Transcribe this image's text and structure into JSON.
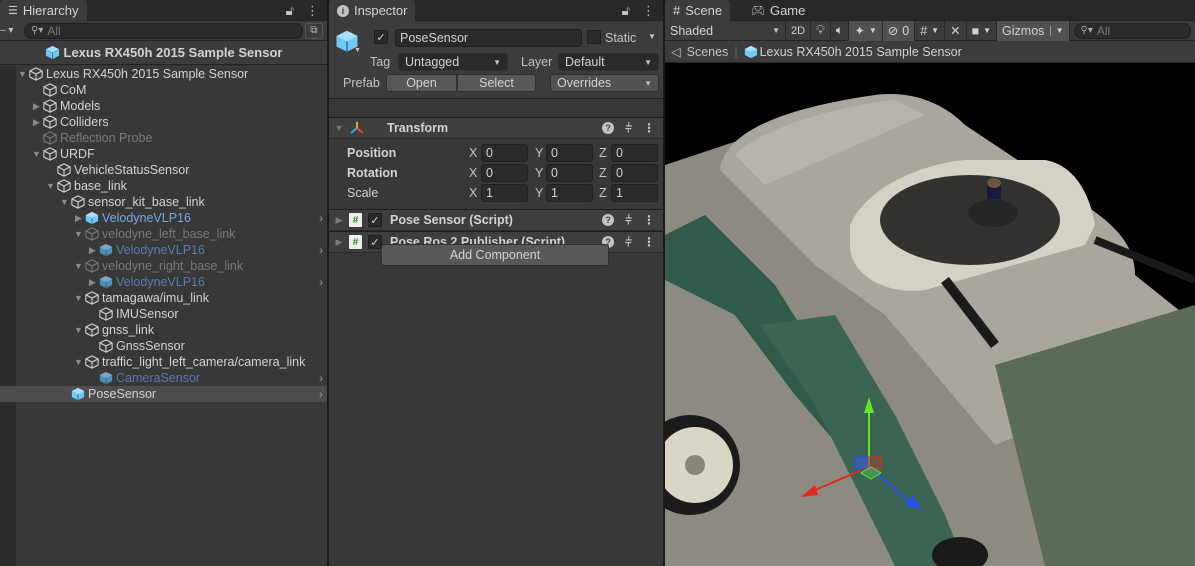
{
  "hierarchy": {
    "tab_label": "Hierarchy",
    "search_placeholder": "All",
    "prefab_header": "Lexus RX450h 2015 Sample Sensor",
    "items": [
      {
        "label": "Lexus RX450h 2015 Sample Sensor",
        "depth": 0,
        "arrow": "down",
        "type": "object"
      },
      {
        "label": "CoM",
        "depth": 1,
        "arrow": "none",
        "type": "object"
      },
      {
        "label": "Models",
        "depth": 1,
        "arrow": "right",
        "type": "object"
      },
      {
        "label": "Colliders",
        "depth": 1,
        "arrow": "right",
        "type": "object"
      },
      {
        "label": "Reflection Probe",
        "depth": 1,
        "arrow": "none",
        "type": "object-disabled"
      },
      {
        "label": "URDF",
        "depth": 1,
        "arrow": "down",
        "type": "object"
      },
      {
        "label": "VehicleStatusSensor",
        "depth": 2,
        "arrow": "none",
        "type": "object"
      },
      {
        "label": "base_link",
        "depth": 2,
        "arrow": "down",
        "type": "object"
      },
      {
        "label": "sensor_kit_base_link",
        "depth": 3,
        "arrow": "down",
        "type": "object"
      },
      {
        "label": "VelodyneVLP16",
        "depth": 4,
        "arrow": "right",
        "type": "prefab",
        "chevron": true
      },
      {
        "label": "velodyne_left_base_link",
        "depth": 4,
        "arrow": "down",
        "type": "object-disabled"
      },
      {
        "label": "VelodyneVLP16",
        "depth": 5,
        "arrow": "right",
        "type": "prefab-disabled",
        "chevron": true
      },
      {
        "label": "velodyne_right_base_link",
        "depth": 4,
        "arrow": "down",
        "type": "object-disabled"
      },
      {
        "label": "VelodyneVLP16",
        "depth": 5,
        "arrow": "right",
        "type": "prefab-disabled",
        "chevron": true
      },
      {
        "label": "tamagawa/imu_link",
        "depth": 4,
        "arrow": "down",
        "type": "object"
      },
      {
        "label": "IMUSensor",
        "depth": 5,
        "arrow": "none",
        "type": "object"
      },
      {
        "label": "gnss_link",
        "depth": 4,
        "arrow": "down",
        "type": "object"
      },
      {
        "label": "GnssSensor",
        "depth": 5,
        "arrow": "none",
        "type": "object"
      },
      {
        "label": "traffic_light_left_camera/camera_link",
        "depth": 4,
        "arrow": "down",
        "type": "object"
      },
      {
        "label": "CameraSensor",
        "depth": 5,
        "arrow": "none",
        "type": "prefab-disabled",
        "chevron": true
      },
      {
        "label": "PoseSensor",
        "depth": 3,
        "arrow": "none",
        "type": "prefab-selected",
        "chevron": true,
        "selected": true
      }
    ]
  },
  "inspector": {
    "tab_label": "Inspector",
    "object_name": "PoseSensor",
    "active": true,
    "static_label": "Static",
    "static_checked": false,
    "tag_label": "Tag",
    "tag_value": "Untagged",
    "layer_label": "Layer",
    "layer_value": "Default",
    "prefab_label": "Prefab",
    "prefab_open": "Open",
    "prefab_select": "Select",
    "prefab_overrides": "Overrides",
    "transform": {
      "title": "Transform",
      "rows": [
        {
          "label": "Position",
          "x": "0",
          "y": "0",
          "z": "0",
          "bold": true
        },
        {
          "label": "Rotation",
          "x": "0",
          "y": "0",
          "z": "0",
          "bold": true
        },
        {
          "label": "Scale",
          "x": "1",
          "y": "1",
          "z": "1",
          "bold": false
        }
      ],
      "axis_x": "X",
      "axis_y": "Y",
      "axis_z": "Z"
    },
    "components": [
      {
        "title": "Pose Sensor (Script)",
        "enabled": true
      },
      {
        "title": "Pose Ros 2 Publisher (Script)",
        "enabled": true
      }
    ],
    "add_component": "Add Component"
  },
  "scene": {
    "tab_scene": "Scene",
    "tab_game": "Game",
    "shading_mode": "Shaded",
    "mode_2d": "2D",
    "hidden_count": "0",
    "gizmos": "Gizmos",
    "search_placeholder": "All",
    "breadcrumb_root": "Scenes",
    "breadcrumb_prefab": "Lexus RX450h 2015 Sample Sensor"
  },
  "colors": {
    "prefab_blue": "#7ba8e6",
    "cube_blue": "#6fc8f5",
    "axis_x": "#e0291e",
    "axis_y": "#5fe62a",
    "axis_z": "#2450f0",
    "panel_bg": "#383838"
  }
}
